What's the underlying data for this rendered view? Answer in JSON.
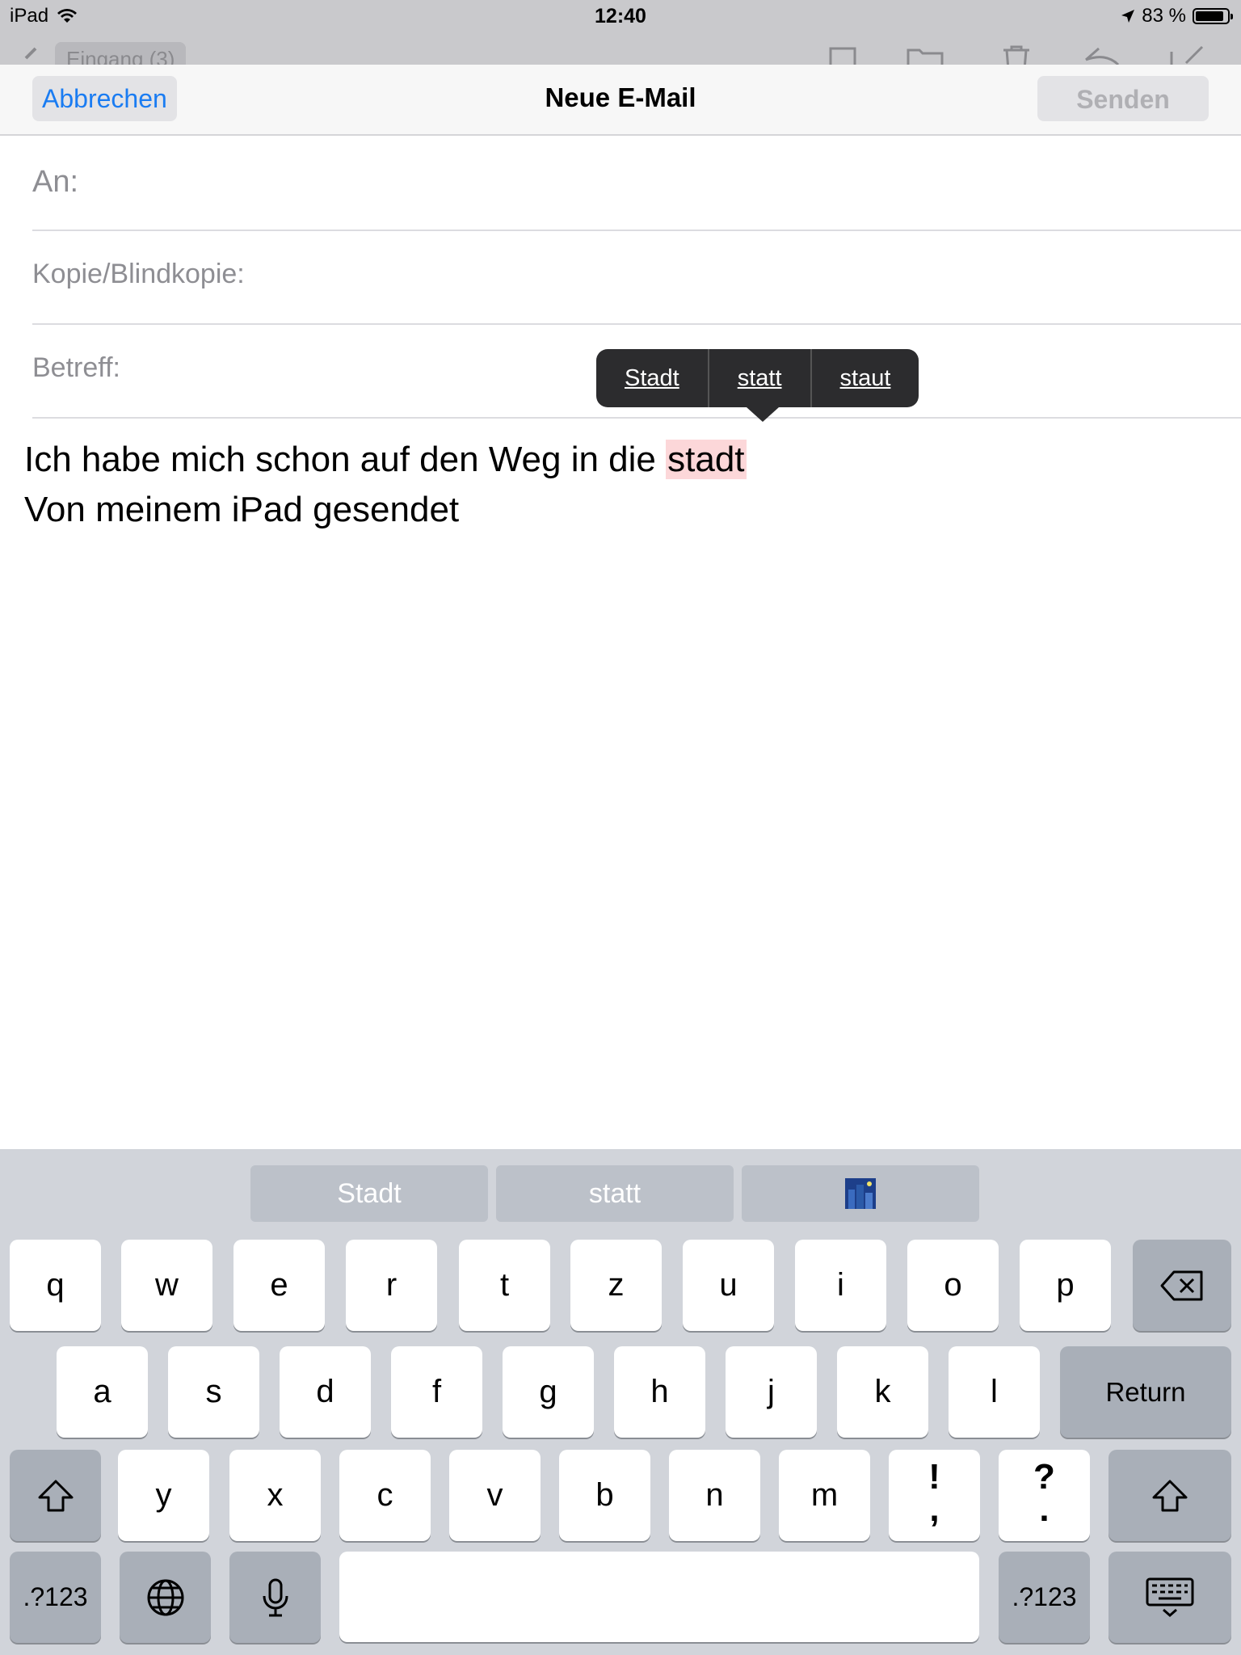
{
  "status_bar": {
    "device": "iPad",
    "time": "12:40",
    "battery": "83 %"
  },
  "background_toolbar": {
    "back_label": "Eingang (3)"
  },
  "compose": {
    "cancel_label": "Abbrechen",
    "title": "Neue E-Mail",
    "send_label": "Senden"
  },
  "fields": {
    "to_label": "An:",
    "cc_label": "Kopie/Blindkopie:",
    "subject_label": "Betreff:"
  },
  "body": {
    "line1_prefix": "Ich habe mich schon auf den Weg in die ",
    "line1_misspelled": "stadt",
    "signature": "Von meinem iPad gesendet"
  },
  "autocorrect": {
    "options": [
      "Stadt",
      "statt",
      "staut"
    ]
  },
  "keyboard": {
    "suggestions": [
      "Stadt",
      "statt"
    ],
    "row1": [
      "q",
      "w",
      "e",
      "r",
      "t",
      "z",
      "u",
      "i",
      "o",
      "p"
    ],
    "row2": [
      "a",
      "s",
      "d",
      "f",
      "g",
      "h",
      "j",
      "k",
      "l"
    ],
    "row3": [
      "y",
      "x",
      "c",
      "v",
      "b",
      "n",
      "m"
    ],
    "punct1_top": "!",
    "punct1_bottom": ",",
    "punct2_top": "?",
    "punct2_bottom": ".",
    "return_label": "Return",
    "mode_label": ".?123"
  },
  "colors": {
    "accent": "#1a7cf2",
    "misspelled_highlight": "#fcd7d9",
    "keyboard_bg": "#d1d4da"
  }
}
